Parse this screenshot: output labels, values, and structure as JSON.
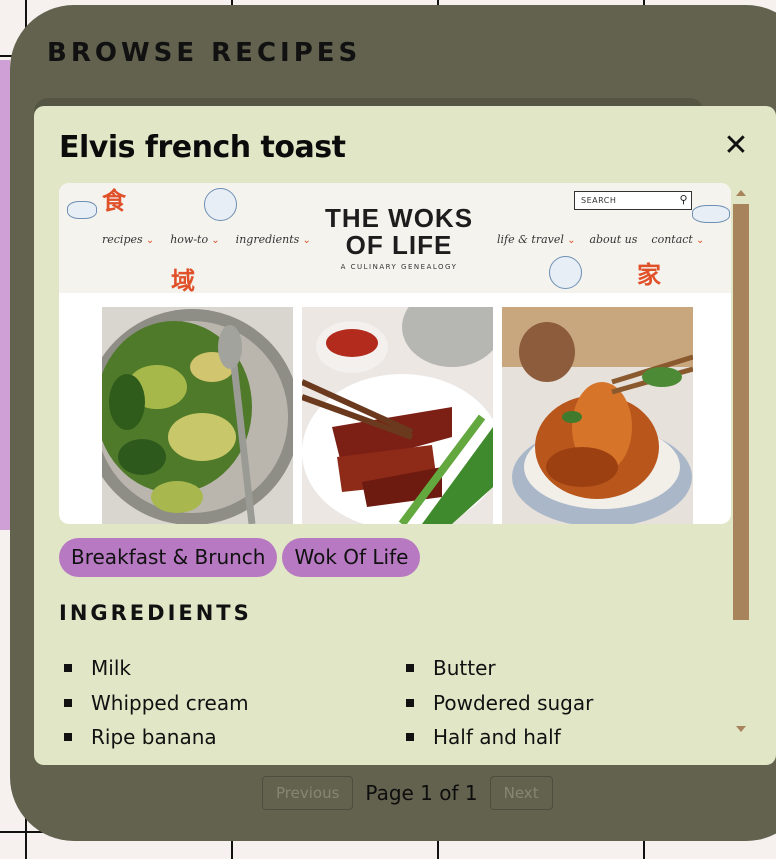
{
  "page": {
    "title": "BROWSE RECIPES",
    "pagination": {
      "previous_label": "Previous",
      "page_text": "Page 1 of 1",
      "next_label": "Next"
    }
  },
  "modal": {
    "title": "Elvis french toast",
    "close_glyph": "✕",
    "image": {
      "site_title_line1": "THE WOKS",
      "site_title_line2": "OF LIFE",
      "site_tagline": "A CULINARY GENEALOGY",
      "nav_left": [
        "recipes",
        "how-to",
        "ingredients"
      ],
      "nav_right": [
        "life & travel",
        "about us",
        "contact"
      ],
      "search_placeholder": "SEARCH",
      "glyphs": [
        "食",
        "域",
        "家"
      ]
    },
    "tags": [
      "Breakfast & Brunch",
      "Wok Of Life"
    ],
    "ingredients_heading": "INGREDIENTS",
    "ingredients_left": [
      "Milk",
      "Whipped cream",
      "Ripe banana"
    ],
    "ingredients_right": [
      "Butter",
      "Powdered sugar",
      "Half and half"
    ]
  },
  "colors": {
    "panel": "#62624f",
    "modal": "#e0e6c6",
    "tag": "#b779c2",
    "scrollbar": "#a7845c",
    "accent_red": "#e0512a"
  }
}
